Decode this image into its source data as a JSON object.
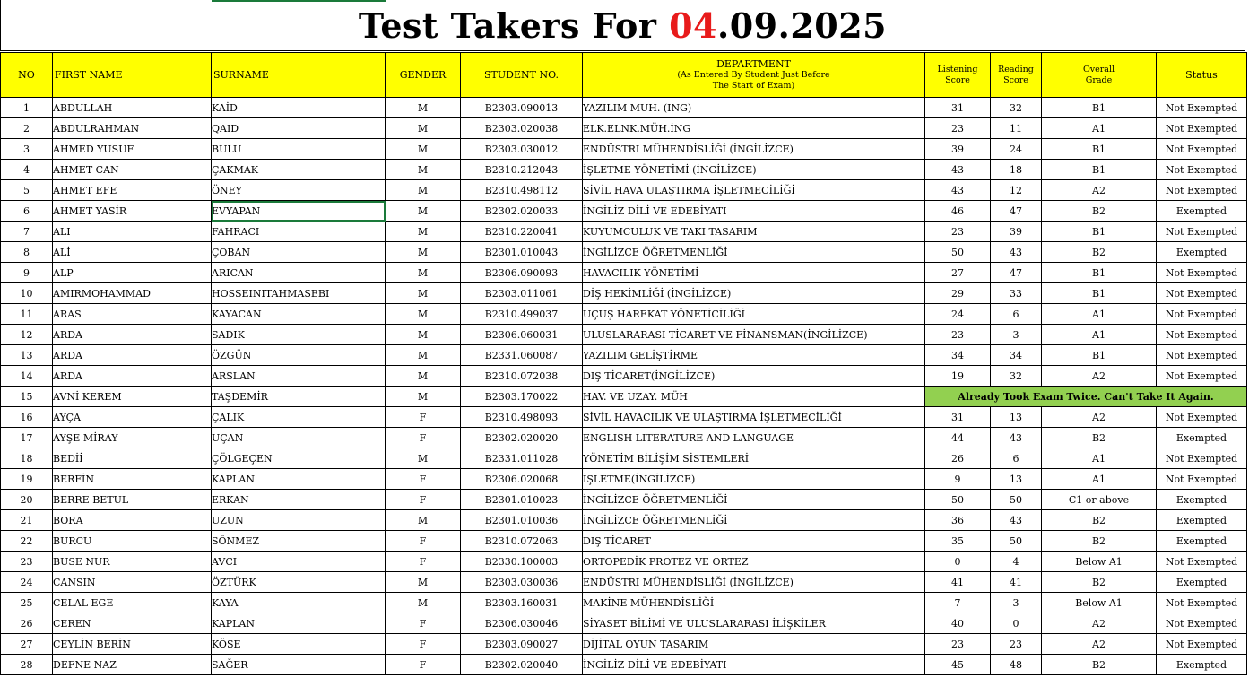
{
  "title": {
    "prefix": "Test Takers For ",
    "date_red": "04",
    "date_rest": ".09.2025"
  },
  "headers": {
    "no": "NO",
    "first_name": "FIRST NAME",
    "surname": "SURNAME",
    "gender": "GENDER",
    "student_no": "STUDENT NO.",
    "department": "DEPARTMENT",
    "department_sub1": "(As Entered By Student Just Before",
    "department_sub2": "The Start of Exam)",
    "listening1": "Listening",
    "listening2": "Score",
    "reading1": "Reading",
    "reading2": "Score",
    "overall1": "Overall",
    "overall2": "Grade",
    "status": "Status"
  },
  "rows": [
    {
      "no": "1",
      "first": "ABDULLAH",
      "surname": "KAİD",
      "gender": "M",
      "student_no": "B2303.090013",
      "dept": "YAZILIM MUH. (ING)",
      "listening": "31",
      "reading": "32",
      "grade": "B1",
      "status": "Not Exempted"
    },
    {
      "no": "2",
      "first": "ABDULRAHMAN",
      "surname": "QAID",
      "gender": "M",
      "student_no": "B2303.020038",
      "dept": "ELK.ELNK.MÜH.İNG",
      "listening": "23",
      "reading": "11",
      "grade": "A1",
      "status": "Not Exempted"
    },
    {
      "no": "3",
      "first": "AHMED YUSUF",
      "surname": "BULU",
      "gender": "M",
      "student_no": "B2303.030012",
      "dept": "ENDÜSTRI MÜHENDİSLİĞİ (İNGİLİZCE)",
      "listening": "39",
      "reading": "24",
      "grade": "B1",
      "status": "Not Exempted"
    },
    {
      "no": "4",
      "first": "AHMET CAN",
      "surname": "ÇAKMAK",
      "gender": "M",
      "student_no": "B2310.212043",
      "dept": "İŞLETME YÖNETİMİ (İNGİLİZCE)",
      "listening": "43",
      "reading": "18",
      "grade": "B1",
      "status": "Not Exempted"
    },
    {
      "no": "5",
      "first": "AHMET EFE",
      "surname": "ÖNEY",
      "gender": "M",
      "student_no": "B2310.498112",
      "dept": "SİVİL HAVA ULAŞTIRMA İŞLETMECİLİĞİ",
      "listening": "43",
      "reading": "12",
      "grade": "A2",
      "status": "Not Exempted"
    },
    {
      "no": "6",
      "first": "AHMET YASİR",
      "surname": "EVYAPAN",
      "gender": "M",
      "student_no": "B2302.020033",
      "dept": "İNGİLİZ DİLİ VE EDEBİYATI",
      "listening": "46",
      "reading": "47",
      "grade": "B2",
      "status": "Exempted"
    },
    {
      "no": "7",
      "first": "ALI",
      "surname": "FAHRACI",
      "gender": "M",
      "student_no": "B2310.220041",
      "dept": "KUYUMCULUK VE TAKI TASARIM",
      "listening": "23",
      "reading": "39",
      "grade": "B1",
      "status": "Not Exempted"
    },
    {
      "no": "8",
      "first": "ALİ",
      "surname": "ÇOBAN",
      "gender": "M",
      "student_no": "B2301.010043",
      "dept": "İNGİLİZCE ÖĞRETMENLİĞİ",
      "listening": "50",
      "reading": "43",
      "grade": "B2",
      "status": "Exempted"
    },
    {
      "no": "9",
      "first": "ALP",
      "surname": "ARICAN",
      "gender": "M",
      "student_no": "B2306.090093",
      "dept": "HAVACILIK YÖNETİMİ",
      "listening": "27",
      "reading": "47",
      "grade": "B1",
      "status": "Not Exempted"
    },
    {
      "no": "10",
      "first": "AMIRMOHAMMAD",
      "surname": "HOSSEINITAHMASEBI",
      "gender": "M",
      "student_no": "B2303.011061",
      "dept": "DİŞ HEKİMLİĞİ (İNGİLİZCE)",
      "listening": "29",
      "reading": "33",
      "grade": "B1",
      "status": "Not Exempted"
    },
    {
      "no": "11",
      "first": "ARAS",
      "surname": "KAYACAN",
      "gender": "M",
      "student_no": "B2310.499037",
      "dept": "UÇUŞ HAREKAT YÖNETİCİLİĞİ",
      "listening": "24",
      "reading": "6",
      "grade": "A1",
      "status": "Not Exempted"
    },
    {
      "no": "12",
      "first": "ARDA",
      "surname": "SADIK",
      "gender": "M",
      "student_no": "B2306.060031",
      "dept": "ULUSLARARASI TİCARET VE FİNANSMAN(İNGİLİZCE)",
      "listening": "23",
      "reading": "3",
      "grade": "A1",
      "status": "Not Exempted"
    },
    {
      "no": "13",
      "first": "ARDA",
      "surname": "ÖZGÜN",
      "gender": "M",
      "student_no": "B2331.060087",
      "dept": "YAZILIM GELİŞTİRME",
      "listening": "34",
      "reading": "34",
      "grade": "B1",
      "status": "Not Exempted"
    },
    {
      "no": "14",
      "first": "ARDA",
      "surname": "ARSLAN",
      "gender": "M",
      "student_no": "B2310.072038",
      "dept": "DIŞ TİCARET(İNGİLİZCE)",
      "listening": "19",
      "reading": "32",
      "grade": "A2",
      "status": "Not Exempted"
    },
    {
      "no": "15",
      "first": "AVNİ KEREM",
      "surname": "TAŞDEMİR",
      "gender": "M",
      "student_no": "B2303.170022",
      "dept": "HAV. VE UZAY. MÜH",
      "notice": "Already Took Exam Twice. Can't Take It Again."
    },
    {
      "no": "16",
      "first": "AYÇA",
      "surname": "ÇALIK",
      "gender": "F",
      "student_no": "B2310.498093",
      "dept": "SİVİL HAVACILIK VE ULAŞTIRMA İŞLETMECİLİĞİ",
      "listening": "31",
      "reading": "13",
      "grade": "A2",
      "status": "Not Exempted"
    },
    {
      "no": "17",
      "first": "AYŞE MİRAY",
      "surname": "UÇAN",
      "gender": "F",
      "student_no": "B2302.020020",
      "dept": "ENGLISH LITERATURE AND LANGUAGE",
      "listening": "44",
      "reading": "43",
      "grade": "B2",
      "status": "Exempted"
    },
    {
      "no": "18",
      "first": "BEDİİ",
      "surname": "ÇÖLGEÇEN",
      "gender": "M",
      "student_no": "B2331.011028",
      "dept": "YÖNETİM BİLİŞİM SİSTEMLERİ",
      "listening": "26",
      "reading": "6",
      "grade": "A1",
      "status": "Not Exempted"
    },
    {
      "no": "19",
      "first": "BERFİN",
      "surname": "KAPLAN",
      "gender": "F",
      "student_no": "B2306.020068",
      "dept": "İŞLETME(İNGİLİZCE)",
      "listening": "9",
      "reading": "13",
      "grade": "A1",
      "status": "Not Exempted"
    },
    {
      "no": "20",
      "first": "BERRE BETUL",
      "surname": "ERKAN",
      "gender": "F",
      "student_no": "B2301.010023",
      "dept": "İNGİLİZCE ÖĞRETMENLİĞİ",
      "listening": "50",
      "reading": "50",
      "grade": "C1 or above",
      "status": "Exempted"
    },
    {
      "no": "21",
      "first": "BORA",
      "surname": "UZUN",
      "gender": "M",
      "student_no": "B2301.010036",
      "dept": "İNGİLİZCE ÖĞRETMENLİĞİ",
      "listening": "36",
      "reading": "43",
      "grade": "B2",
      "status": "Exempted"
    },
    {
      "no": "22",
      "first": "BURCU",
      "surname": "SÖNMEZ",
      "gender": "F",
      "student_no": "B2310.072063",
      "dept": "DIŞ TİCARET",
      "listening": "35",
      "reading": "50",
      "grade": "B2",
      "status": "Exempted"
    },
    {
      "no": "23",
      "first": "BUSE NUR",
      "surname": "AVCI",
      "gender": "F",
      "student_no": "B2330.100003",
      "dept": "ORTOPEDİK PROTEZ VE ORTEZ",
      "listening": "0",
      "reading": "4",
      "grade": "Below A1",
      "status": "Not Exempted"
    },
    {
      "no": "24",
      "first": "CANSIN",
      "surname": "ÖZTÜRK",
      "gender": "M",
      "student_no": "B2303.030036",
      "dept": "ENDÜSTRI MÜHENDİSLİĞİ (İNGİLİZCE)",
      "listening": "41",
      "reading": "41",
      "grade": "B2",
      "status": "Exempted"
    },
    {
      "no": "25",
      "first": "CELAL EGE",
      "surname": "KAYA",
      "gender": "M",
      "student_no": "B2303.160031",
      "dept": "MAKİNE MÜHENDİSLİĞİ",
      "listening": "7",
      "reading": "3",
      "grade": "Below A1",
      "status": "Not Exempted"
    },
    {
      "no": "26",
      "first": "CEREN",
      "surname": "KAPLAN",
      "gender": "F",
      "student_no": "B2306.030046",
      "dept": "SİYASET BİLİMİ VE ULUSLARARASI İLİŞKİLER",
      "listening": "40",
      "reading": "0",
      "grade": "A2",
      "status": "Not Exempted"
    },
    {
      "no": "27",
      "first": "CEYLİN BERİN",
      "surname": "KÖSE",
      "gender": "F",
      "student_no": "B2303.090027",
      "dept": "DİJİTAL OYUN TASARIM",
      "listening": "23",
      "reading": "23",
      "grade": "A2",
      "status": "Not Exempted"
    },
    {
      "no": "28",
      "first": "DEFNE NAZ",
      "surname": "SAĞER",
      "gender": "F",
      "student_no": "B2302.020040",
      "dept": "İNGİLİZ DİLİ VE EDEBİYATI",
      "listening": "45",
      "reading": "48",
      "grade": "B2",
      "status": "Exempted"
    }
  ]
}
